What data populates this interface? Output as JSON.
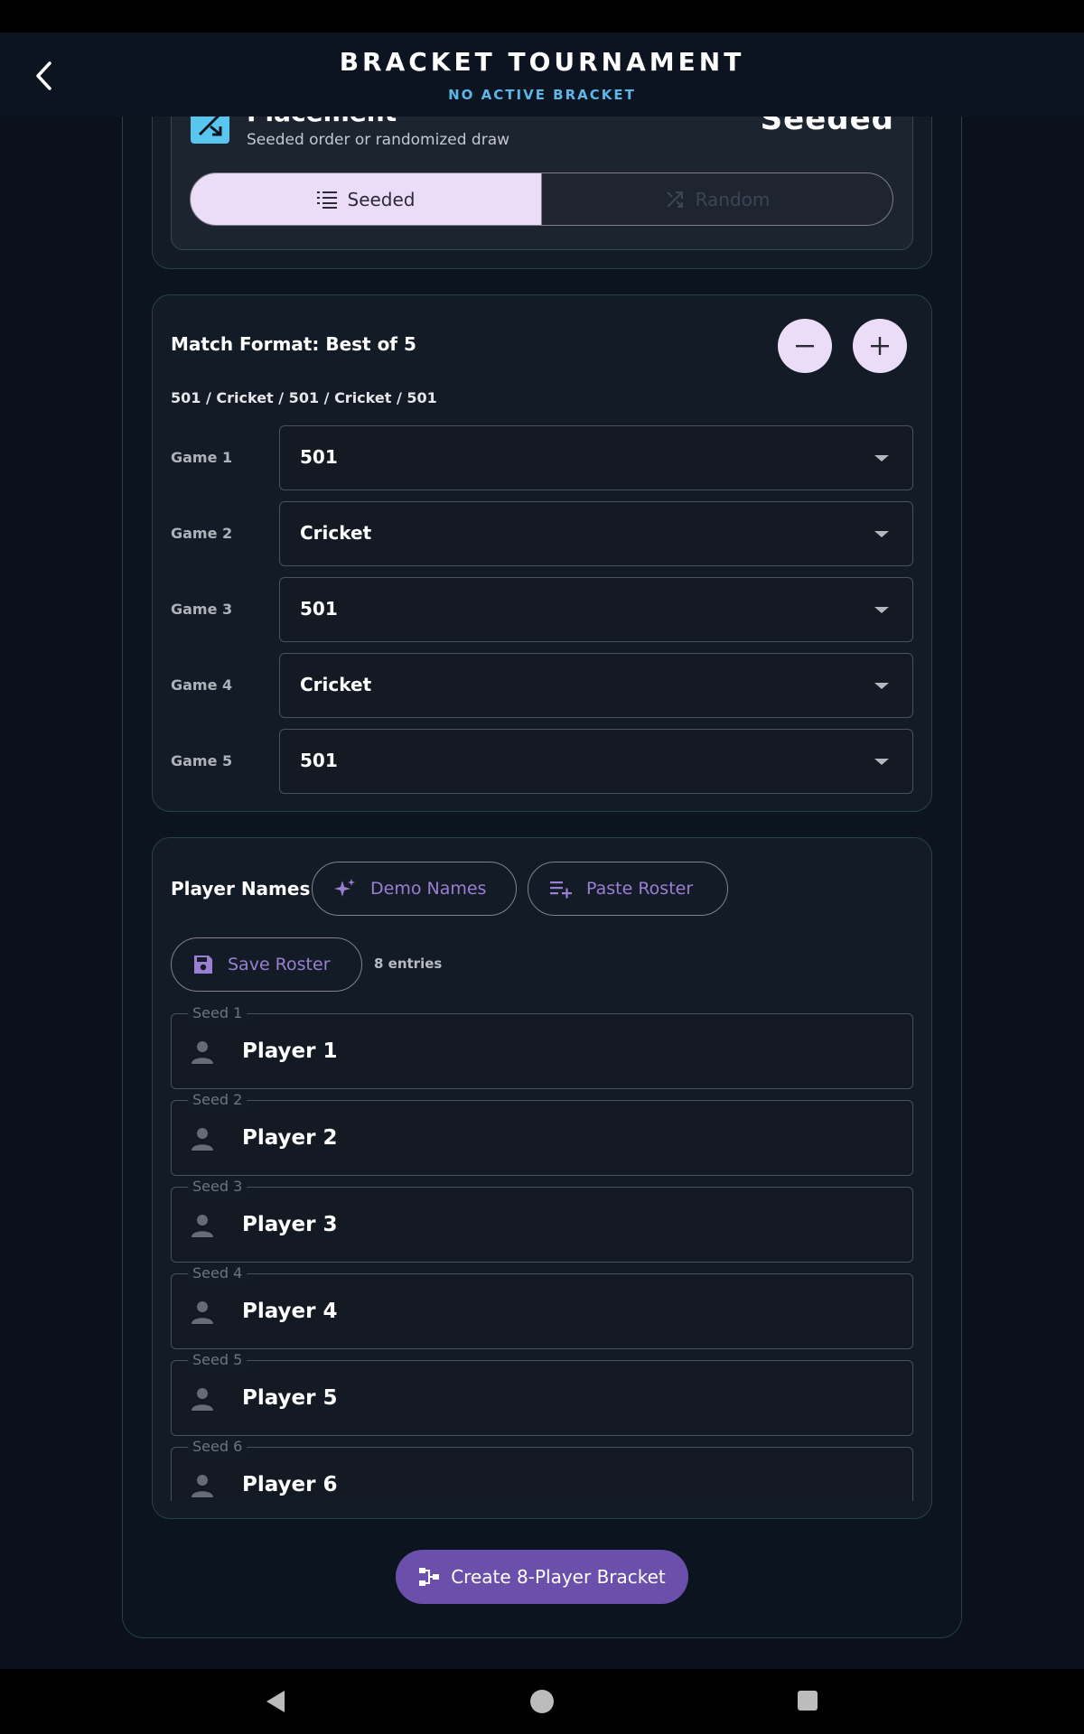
{
  "header": {
    "title": "BRACKET TOURNAMENT",
    "subtitle": "NO ACTIVE BRACKET"
  },
  "placement": {
    "title": "Placement",
    "description": "Seeded order or randomized draw",
    "value": "Seeded",
    "options": [
      "Seeded",
      "Random"
    ],
    "selected": "Seeded"
  },
  "match_format": {
    "title": "Match Format: Best of 5",
    "summary": "501 / Cricket / 501 / Cricket / 501",
    "games": [
      {
        "label": "Game 1",
        "value": "501"
      },
      {
        "label": "Game 2",
        "value": "Cricket"
      },
      {
        "label": "Game 3",
        "value": "501"
      },
      {
        "label": "Game 4",
        "value": "Cricket"
      },
      {
        "label": "Game 5",
        "value": "501"
      }
    ]
  },
  "players": {
    "title": "Player Names",
    "demo_label": "Demo Names",
    "paste_label": "Paste Roster",
    "save_label": "Save Roster",
    "entries": "8 entries",
    "list": [
      {
        "seed": "Seed 1",
        "name": "Player 1"
      },
      {
        "seed": "Seed 2",
        "name": "Player 2"
      },
      {
        "seed": "Seed 3",
        "name": "Player 3"
      },
      {
        "seed": "Seed 4",
        "name": "Player 4"
      },
      {
        "seed": "Seed 5",
        "name": "Player 5"
      },
      {
        "seed": "Seed 6",
        "name": "Player 6"
      }
    ]
  },
  "create_label": "Create 8-Player Bracket",
  "colors": {
    "accent": "#6a4fab",
    "accent_light": "#ebdcf8",
    "cyan": "#5cb6e6",
    "background": "#0a111b"
  }
}
